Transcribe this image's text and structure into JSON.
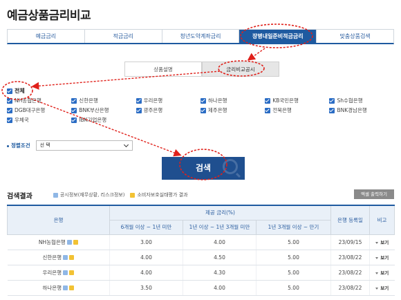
{
  "page": {
    "title": "예금상품금리비교"
  },
  "tabs": [
    {
      "label": "예금금리"
    },
    {
      "label": "적금금리"
    },
    {
      "label": "청년도약계좌금리"
    },
    {
      "label": "장병내일준비적금금리"
    },
    {
      "label": "맞춤상품검색"
    }
  ],
  "subtabs": [
    {
      "label": "상품설명"
    },
    {
      "label": "금리비교공시"
    }
  ],
  "filter": {
    "all_label": "전체",
    "banks": [
      "NH농협은행",
      "신한은행",
      "우리은행",
      "하나은행",
      "KB국민은행",
      "Sh수협은행",
      "DGB대구은행",
      "BNK부산은행",
      "광주은행",
      "제주은행",
      "전북은행",
      "BNK경남은행",
      "우체국",
      "IBK기업은행"
    ]
  },
  "sort": {
    "label": "정렬조건",
    "value": "선 택"
  },
  "search_button": "검색",
  "results": {
    "title": "검색결과",
    "legend_public": "공시정보(재무상황, 리스크정보)",
    "legend_consumer": "소비자보호실태평가 결과",
    "excel_label": "엑셀 출력하기",
    "headers": {
      "bank": "은행",
      "rate_group": "제공 금리(%)",
      "period1": "6개월 이상 ~ 1년 미만",
      "period2": "1년 이상 ~ 1년 3개월 미만",
      "period3": "1년 3개월 이상 ~ 만기",
      "date": "은행 등록일",
      "note": "비고"
    },
    "view_label": "보기",
    "rows": [
      {
        "bank": "NH농협은행",
        "r1": "3.00",
        "r2": "4.00",
        "r3": "5.00",
        "date": "23/09/15"
      },
      {
        "bank": "신한은행",
        "r1": "4.00",
        "r2": "4.50",
        "r3": "5.00",
        "date": "23/08/22"
      },
      {
        "bank": "우리은행",
        "r1": "4.00",
        "r2": "4.30",
        "r3": "5.00",
        "date": "23/08/22"
      },
      {
        "bank": "하나은행",
        "r1": "3.50",
        "r2": "4.00",
        "r3": "5.00",
        "date": "23/08/22"
      }
    ]
  },
  "colors": {
    "primary": "#1e5aa0",
    "annotation": "#e0201a",
    "header_bg": "#e9f0f8"
  }
}
